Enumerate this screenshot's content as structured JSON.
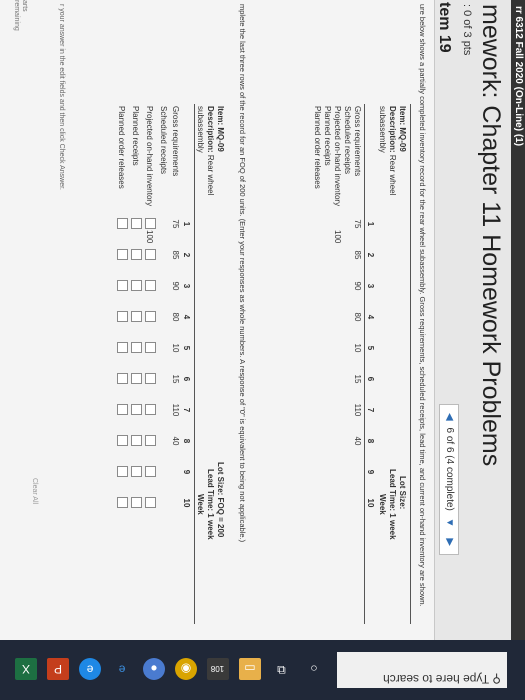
{
  "course": "rr 6312 Fall 2020 (On-Line) (1)",
  "title": "mework: Chapter 11 Homework Problems",
  "score": ": 0 of 3 pts",
  "question": "tem 19",
  "nav": {
    "prev_icon": "triangle-left",
    "label": "6 of 6 (4 complete)",
    "menu_icon": "triangle-down",
    "next_icon": "triangle-right"
  },
  "intro": "ure below shows a partially completed inventory record for the rear wheel subassembly. Gross requirements, scheduled receipts, lead time, and current on-hand inventory are shown.",
  "instructions": "mplete the last three rows of the record for an FOQ of 200 units. (Enter your responses as whole numbers. A response of \"0\" is equivalent to being not applicable.)",
  "table1": {
    "item": "Item: MQ-09",
    "description_label": "Description:",
    "description_value": "Rear wheel",
    "description_value2": "subassembly",
    "lot_size": "Lot Size:",
    "lead_time": "Lead Time: 1 week",
    "week": "Week",
    "weeks": [
      "1",
      "2",
      "3",
      "4",
      "5",
      "6",
      "7",
      "8",
      "9",
      "10"
    ],
    "rows": [
      "Gross requirements",
      "Scheduled receipts",
      "Projected on-hand inventory",
      "Planned receipts",
      "Planned order releases"
    ],
    "gross": [
      "75",
      "85",
      "90",
      "80",
      "10",
      "15",
      "110",
      "40",
      "",
      ""
    ],
    "initial_on_hand": "100"
  },
  "table2": {
    "item": "Item: MQ-09",
    "description_label": "Description:",
    "description_value": "Rear wheel",
    "description_value2": "subassembly",
    "lot_size": "Lot Size: FOQ = 200",
    "lead_time": "Lead Time: 1 week",
    "week": "Week",
    "weeks": [
      "1",
      "2",
      "3",
      "4",
      "5",
      "6",
      "7",
      "8",
      "9",
      "10"
    ],
    "rows": [
      "Gross requirements",
      "Scheduled receipts",
      "Projected on-hand inventory",
      "Planned receipts",
      "Planned order releases"
    ],
    "gross": [
      "75",
      "85",
      "90",
      "80",
      "10",
      "15",
      "110",
      "40",
      "",
      ""
    ],
    "initial_on_hand": "100"
  },
  "note": "r your answer in the edit fields and then click Check Answer.",
  "clear_all": "Clear All",
  "left_strip": [
    "arts",
    "remaining"
  ],
  "taskbar": {
    "search_placeholder": "Type here to search",
    "badge": "108",
    "icons": [
      "search-glass",
      "cortana-circle",
      "task-view",
      "file-explorer",
      "store",
      "chrome",
      "edge",
      "firefox",
      "ie",
      "powerpoint",
      "excel"
    ]
  },
  "colors": {
    "accent": "#2e6db4",
    "taskbar": "#202838"
  }
}
